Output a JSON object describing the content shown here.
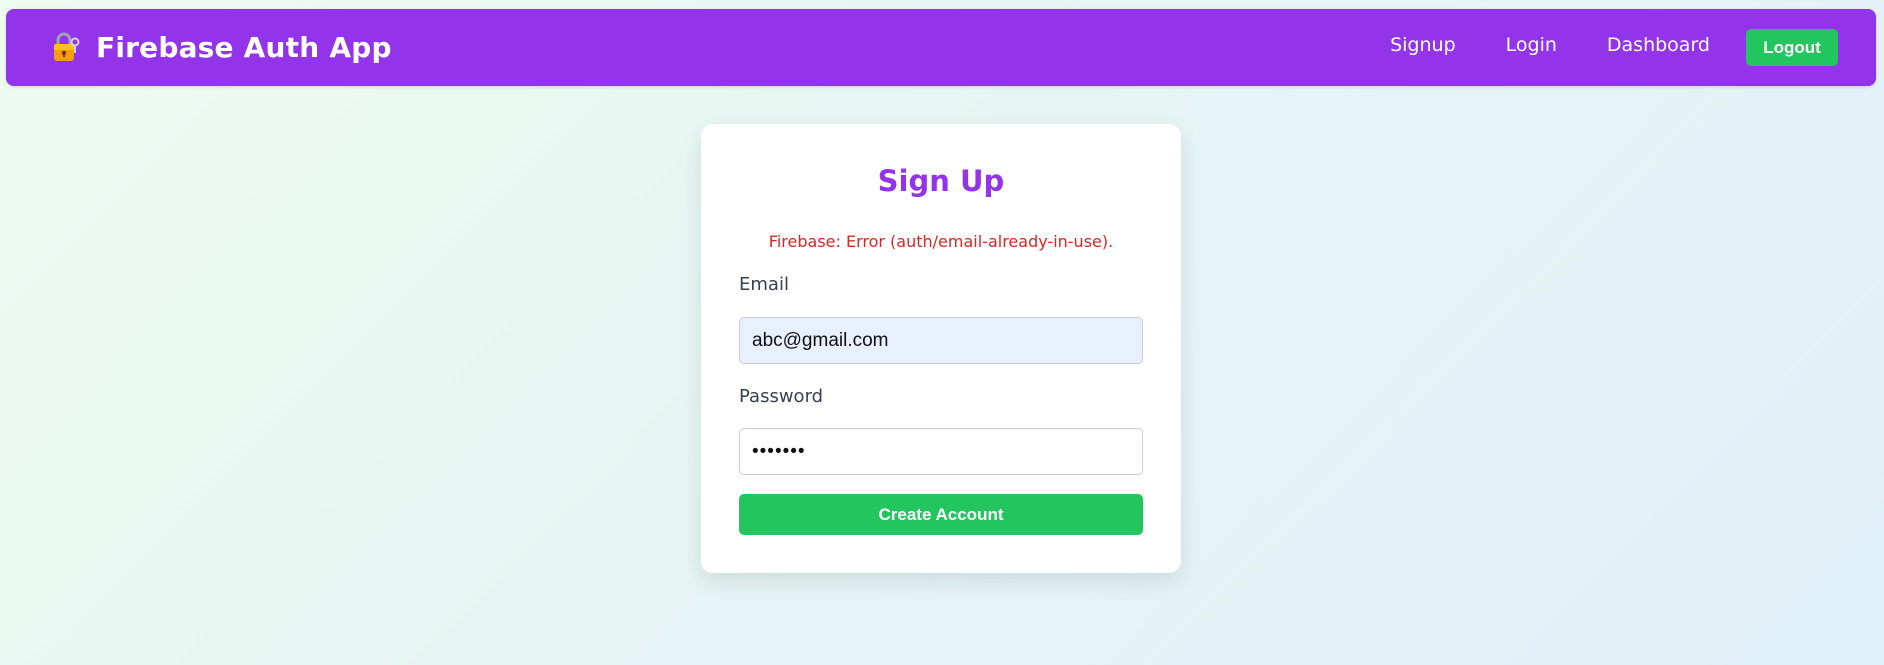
{
  "navbar": {
    "brand_icon": "lock-key-icon",
    "brand_title": "Firebase Auth App",
    "links": [
      "Signup",
      "Login",
      "Dashboard"
    ],
    "logout_label": "Logout",
    "background_color": "#9333ea",
    "logout_color": "#22c55e"
  },
  "signup_form": {
    "title": "Sign Up",
    "error_message": "Firebase: Error (auth/email-already-in-use).",
    "email_label": "Email",
    "email_value": "abc@gmail.com",
    "password_label": "Password",
    "password_value": "1234567",
    "submit_label": "Create Account",
    "title_color": "#9333ea",
    "error_color": "#dc2626",
    "button_color": "#22c55e"
  }
}
